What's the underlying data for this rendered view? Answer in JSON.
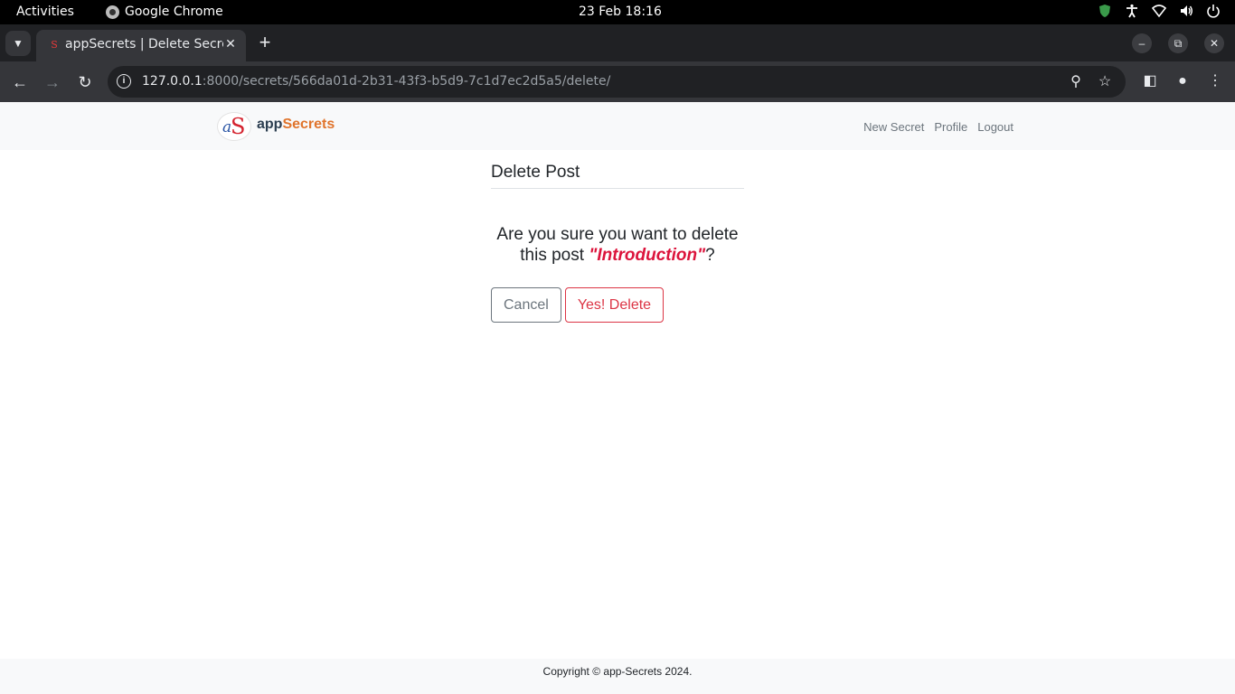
{
  "system_bar": {
    "activities": "Activities",
    "app_name": "Google Chrome",
    "clock": "23 Feb  18:16"
  },
  "browser": {
    "tab_title": "appSecrets | Delete Secret",
    "url_host": "127.0.0.1",
    "url_rest": ":8000/secrets/566da01d-2b31-43f3-b5d9-7c1d7ec2d5a5/delete/"
  },
  "site": {
    "brand_prefix": "app",
    "brand_suffix": "Secrets",
    "nav": {
      "new_secret": "New Secret",
      "profile": "Profile",
      "logout": "Logout"
    }
  },
  "page": {
    "heading": "Delete Post",
    "question_prefix": "Are you sure you want to delete this post ",
    "post_title": "\"Introduction\"",
    "question_suffix": "?",
    "cancel_label": "Cancel",
    "delete_label": "Yes! Delete"
  },
  "footer": {
    "text": "Copyright © app-Secrets 2024."
  },
  "colors": {
    "brand_accent": "#e0742c",
    "danger": "#dc3545",
    "post_title": "#dc143c"
  }
}
